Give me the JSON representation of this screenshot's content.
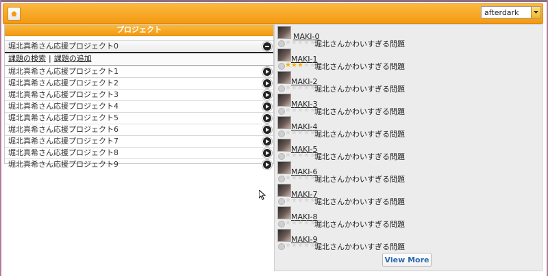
{
  "toolbar": {
    "theme_value": "afterdark"
  },
  "left_panel": {
    "header": "プロジェクト",
    "first_project": "堀北真希さん応援プロジェクト0",
    "search_link": "課題の検索",
    "separator": "|",
    "add_link": "課題の追加",
    "projects": [
      "堀北真希さん応援プロジェクト1",
      "堀北真希さん応援プロジェクト2",
      "堀北真希さん応援プロジェクト3",
      "堀北真希さん応援プロジェクト4",
      "堀北真希さん応援プロジェクト5",
      "堀北真希さん応援プロジェクト6",
      "堀北真希さん応援プロジェクト7",
      "堀北真希さん応援プロジェクト8",
      "堀北真希さん応援プロジェクト9"
    ]
  },
  "right_panel": {
    "items": [
      {
        "name": "MAKI-0",
        "desc": "堀北さんかわいすぎる問題",
        "stars": 0
      },
      {
        "name": "MAKI-1",
        "desc": "堀北さんかわいすぎる問題",
        "stars": 3
      },
      {
        "name": "MAKI-2",
        "desc": "堀北さんかわいすぎる問題",
        "stars": 0
      },
      {
        "name": "MAKI-3",
        "desc": "堀北さんかわいすぎる問題",
        "stars": 0
      },
      {
        "name": "MAKI-4",
        "desc": "堀北さんかわいすぎる問題",
        "stars": 0
      },
      {
        "name": "MAKI-5",
        "desc": "堀北さんかわいすぎる問題",
        "stars": 0
      },
      {
        "name": "MAKI-6",
        "desc": "堀北さんかわいすぎる問題",
        "stars": 0
      },
      {
        "name": "MAKI-7",
        "desc": "堀北さんかわいすぎる問題",
        "stars": 0
      },
      {
        "name": "MAKI-8",
        "desc": "堀北さんかわいすぎる問題",
        "stars": 0
      },
      {
        "name": "MAKI-9",
        "desc": "堀北さんかわいすぎる問題",
        "stars": 0
      }
    ],
    "view_more": "View More"
  },
  "colors": {
    "accent": "#f39a13",
    "link": "#2a69b3",
    "star_on": "#f2b200"
  },
  "icons": [
    "home-icon",
    "chevron-down-icon",
    "arrow-right-icon",
    "minus-icon",
    "star-icon",
    "cursor-icon"
  ]
}
